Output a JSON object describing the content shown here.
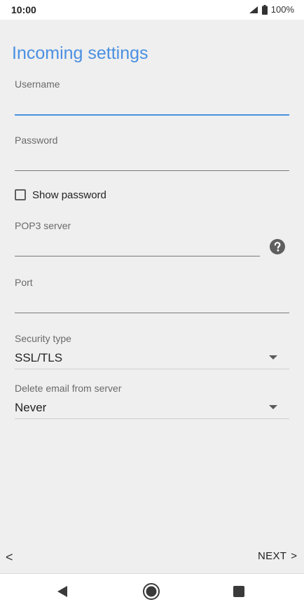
{
  "status": {
    "time": "10:00",
    "battery": "100%"
  },
  "title": "Incoming settings",
  "fields": {
    "username": {
      "label": "Username",
      "value": ""
    },
    "password": {
      "label": "Password",
      "value": ""
    },
    "pop3": {
      "label": "POP3 server",
      "value": ""
    },
    "port": {
      "label": "Port",
      "value": ""
    }
  },
  "show_password": {
    "label": "Show password",
    "checked": false
  },
  "security": {
    "label": "Security type",
    "value": "SSL/TLS"
  },
  "delete_email": {
    "label": "Delete email from server",
    "value": "Never"
  },
  "footer": {
    "back_glyph": "<",
    "next_label": "NEXT",
    "next_glyph": ">"
  },
  "accent_color": "#4a90e2",
  "icons": {
    "signal": "signal-icon",
    "battery": "battery-icon",
    "help": "help-icon",
    "nav_back": "triangle-back-icon",
    "nav_home": "circle-home-icon",
    "nav_recent": "square-recent-icon"
  }
}
